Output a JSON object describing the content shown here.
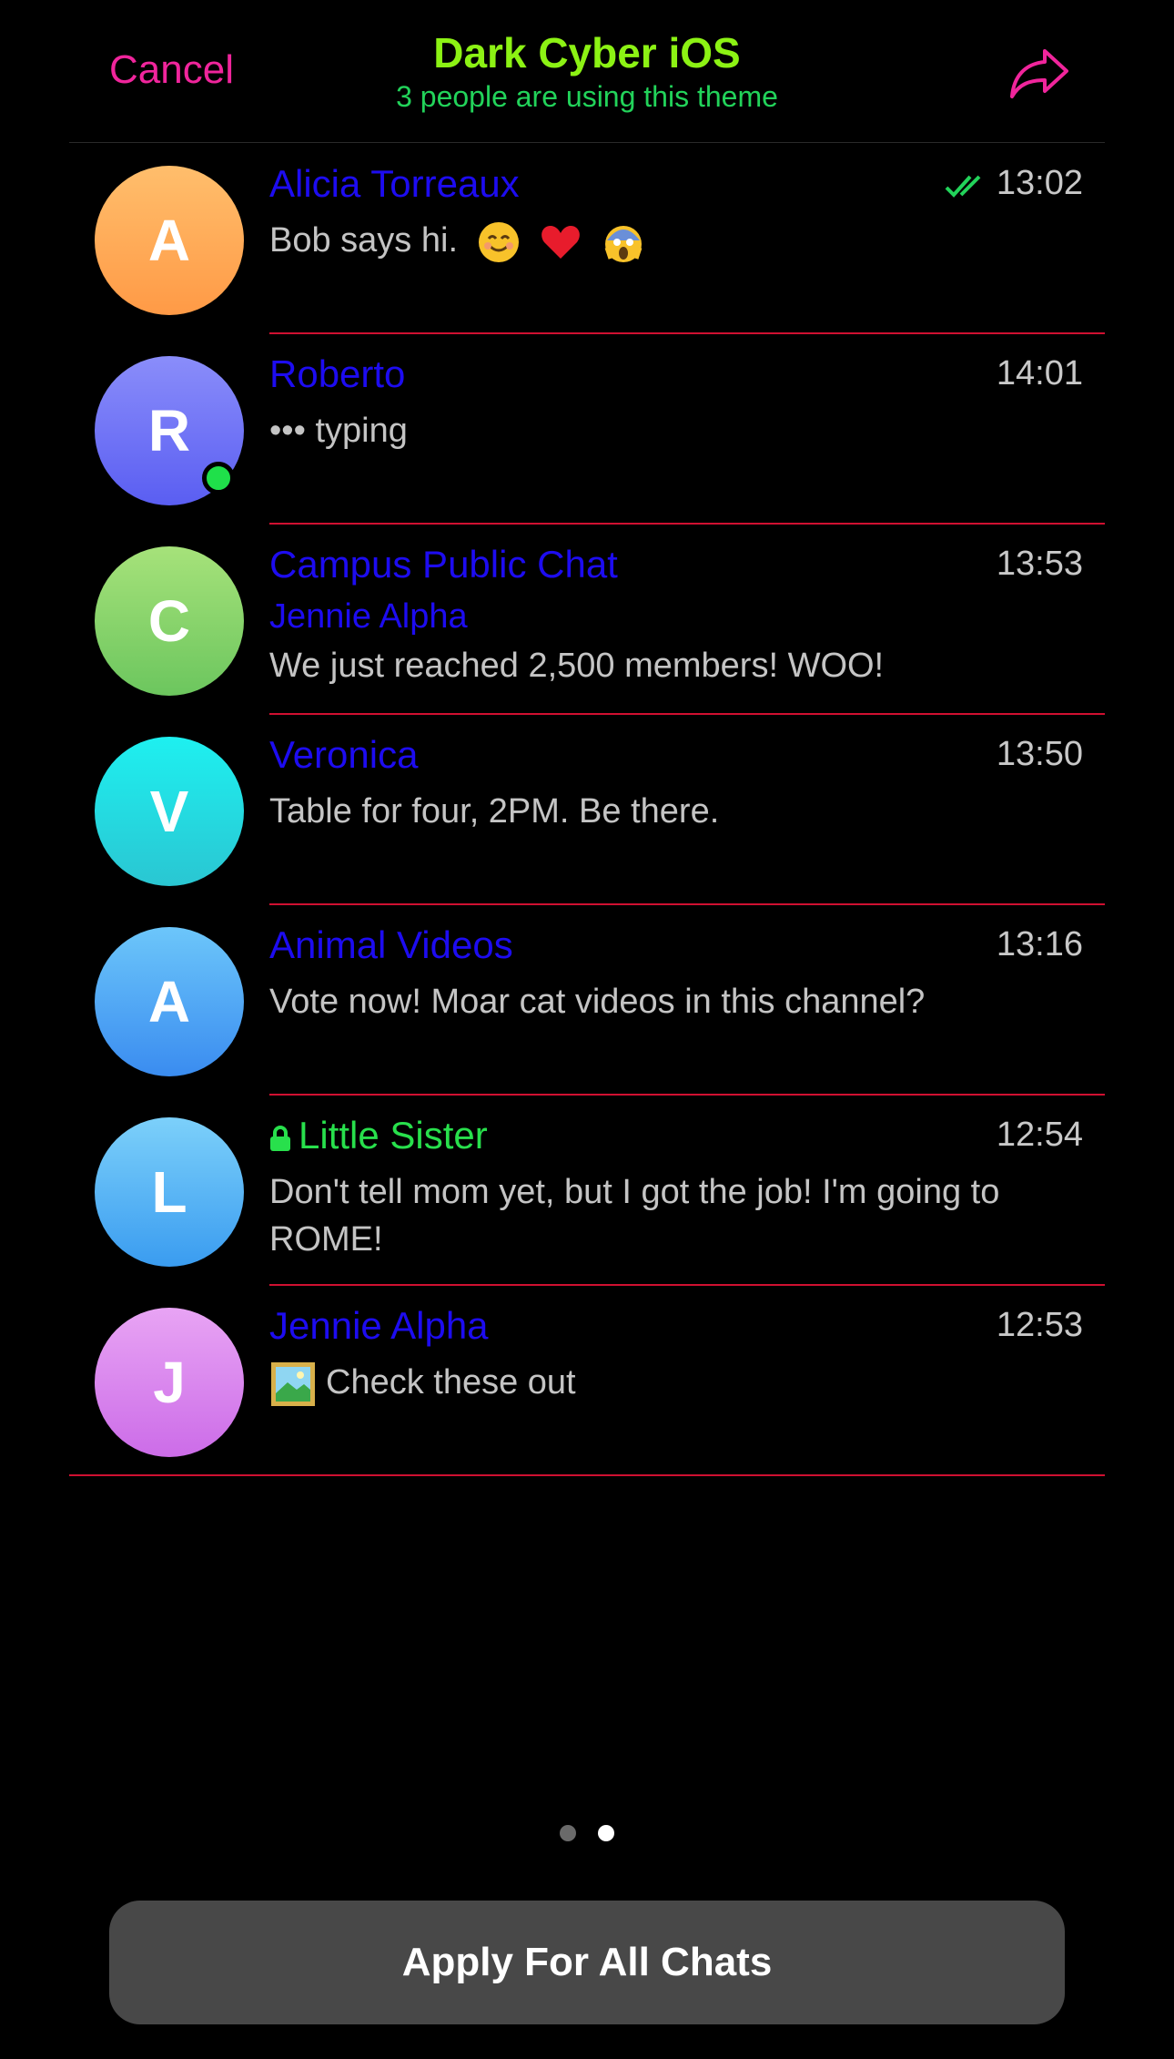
{
  "header": {
    "cancel_label": "Cancel",
    "title": "Dark Cyber iOS",
    "subtitle": "3 people are using this theme",
    "share_icon": "share-arrow-icon"
  },
  "colors": {
    "accent": "#f0259c",
    "title": "#8cf214",
    "subtitle": "#22d35a",
    "chat_name": "#1d0cf0",
    "secret_chat_name": "#28e04c",
    "separator": "#cf1031",
    "online": "#1fe04a"
  },
  "chats": [
    {
      "avatar": "A",
      "name": "Alicia Torreaux",
      "time": "13:02",
      "message": "Bob says hi.",
      "read": true,
      "emoji": [
        "smile-emoji",
        "heart-emoji",
        "scream-emoji"
      ]
    },
    {
      "avatar": "R",
      "name": "Roberto",
      "time": "14:01",
      "message": "••• typing",
      "online": true
    },
    {
      "avatar": "C",
      "name": "Campus Public Chat",
      "time": "13:53",
      "sender": "Jennie Alpha",
      "message": "We just reached 2,500 members! WOO!"
    },
    {
      "avatar": "V",
      "name": "Veronica",
      "time": "13:50",
      "message": "Table for four, 2PM. Be there."
    },
    {
      "avatar": "A",
      "name": "Animal Videos",
      "time": "13:16",
      "message": "Vote now! Moar cat videos in this channel?"
    },
    {
      "avatar": "L",
      "name": "Little Sister",
      "time": "12:54",
      "message": "Don't tell mom yet, but I got the job! I'm going to ROME!",
      "secret": true
    },
    {
      "avatar": "J",
      "name": "Jennie Alpha",
      "time": "12:53",
      "message": "Check these out",
      "attachment_icon": "photo-icon"
    }
  ],
  "pager": {
    "pages": 2,
    "current": 2
  },
  "apply_label": "Apply For All Chats"
}
